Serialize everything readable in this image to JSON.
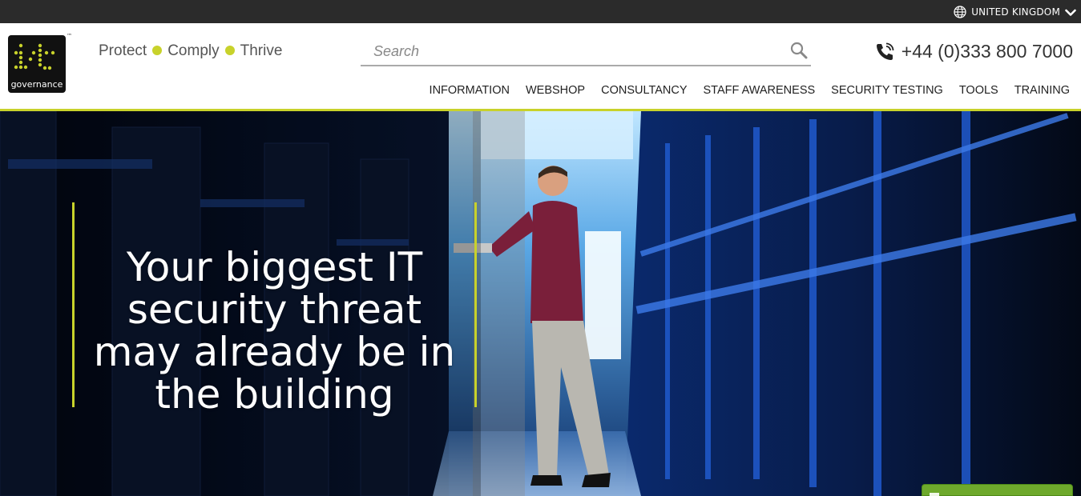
{
  "topbar": {
    "region_label": "UNITED KINGDOM",
    "globe_icon": "globe-icon",
    "chevron_icon": "chevron-down-icon"
  },
  "header": {
    "logo": {
      "text": "governance",
      "trademark": "™",
      "colors": {
        "background": "#111111",
        "dots": "#c8d22b"
      }
    },
    "tagline": [
      "Protect",
      "Comply",
      "Thrive"
    ],
    "search": {
      "placeholder": "Search",
      "value": "",
      "icon": "search-icon"
    },
    "phone": {
      "number": "+44 (0)333 800 7000",
      "icon": "phone-icon"
    },
    "nav": [
      {
        "label": "INFORMATION"
      },
      {
        "label": "WEBSHOP"
      },
      {
        "label": "CONSULTANCY"
      },
      {
        "label": "STAFF AWARENESS"
      },
      {
        "label": "SECURITY TESTING"
      },
      {
        "label": "TOOLS"
      },
      {
        "label": "TRAINING"
      }
    ]
  },
  "hero": {
    "headline": "Your biggest IT security threat may already be in the building"
  },
  "colors": {
    "accent": "#c8d22b",
    "topbar": "#2b2b2b",
    "chat_green": "#6ea92c"
  }
}
